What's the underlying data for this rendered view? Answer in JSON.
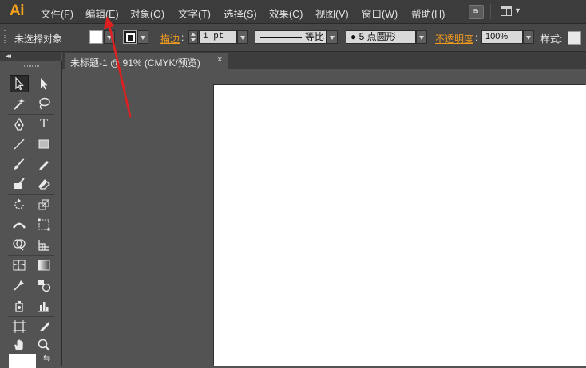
{
  "app": {
    "logo": "Ai",
    "accent_color": "#f7a21b"
  },
  "menubar": {
    "items": [
      "文件(F)",
      "编辑(E)",
      "对象(O)",
      "文字(T)",
      "选择(S)",
      "效果(C)",
      "视图(V)",
      "窗口(W)",
      "帮助(H)"
    ],
    "bridge_label": "Br"
  },
  "controlbar": {
    "selection_status": "未选择对象",
    "stroke_label": "描边",
    "stroke_weight": "1 pt",
    "stroke_profile": "等比",
    "brush": "● 5 点圆形",
    "opacity_label": "不透明度",
    "opacity_value": "100%",
    "style_label": "样式:"
  },
  "document": {
    "tab_title": "未标题-1 @ 91% (CMYK/预览)",
    "close_glyph": "×",
    "artboard_color": "#ffffff"
  },
  "tools": {
    "type_glyph": "T",
    "swap_glyph": "⇆",
    "collapse_glyph": "◂◂",
    "names": [
      "selection",
      "direct-selection",
      "magic-wand",
      "lasso",
      "pen",
      "type",
      "line-segment",
      "rectangle",
      "paintbrush",
      "pencil",
      "blob-brush",
      "eraser",
      "rotate",
      "scale",
      "width",
      "free-transform",
      "shape-builder",
      "perspective-grid",
      "mesh",
      "gradient",
      "eyedropper",
      "blend",
      "symbol-sprayer",
      "column-graph",
      "artboard",
      "slice",
      "hand",
      "zoom"
    ]
  },
  "annotation": {
    "type": "red-arrow",
    "points_to": "编辑(E)",
    "color": "#e02020"
  }
}
